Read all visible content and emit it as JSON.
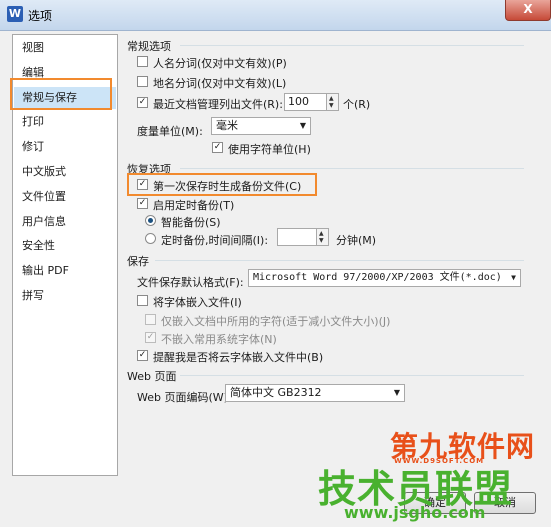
{
  "window": {
    "title": "选项",
    "app_icon": "W",
    "close_glyph": "X"
  },
  "sidebar": {
    "items": [
      {
        "label": "视图"
      },
      {
        "label": "编辑"
      },
      {
        "label": "常规与保存",
        "active": true
      },
      {
        "label": "打印"
      },
      {
        "label": "修订"
      },
      {
        "label": "中文版式"
      },
      {
        "label": "文件位置"
      },
      {
        "label": "用户信息"
      },
      {
        "label": "安全性"
      },
      {
        "label": "输出 PDF"
      },
      {
        "label": "拼写"
      }
    ]
  },
  "general": {
    "title": "常规选项",
    "person_name_segment": {
      "label": "人名分词(仅对中文有效)(P)",
      "checked": false
    },
    "place_name_segment": {
      "label": "地名分词(仅对中文有效)(L)",
      "checked": false
    },
    "recent_docs": {
      "label": "最近文档管理列出文件(R):",
      "checked": true,
      "value": "100",
      "unit": "个(R)"
    },
    "measure_unit_label": "度量单位(M):",
    "measure_unit_value": "毫米",
    "use_char_unit": {
      "label": "使用字符单位(H)",
      "checked": true
    }
  },
  "recovery": {
    "title": "恢复选项",
    "first_save_backup": {
      "label": "第一次保存时生成备份文件(C)",
      "checked": true
    },
    "timed_backup": {
      "label": "启用定时备份(T)",
      "checked": true
    },
    "smart_backup": {
      "label": "智能备份(S)",
      "selected": true
    },
    "interval_backup": {
      "label": "定时备份,时间间隔(I):",
      "selected": false,
      "value": "",
      "unit": "分钟(M)"
    }
  },
  "save": {
    "title": "保存",
    "default_format_label": "文件保存默认格式(F):",
    "default_format_value": "Microsoft Word 97/2000/XP/2003 文件(*.doc)",
    "embed_fonts": {
      "label": "将字体嵌入文件(I)",
      "checked": false
    },
    "embed_used_chars": {
      "label": "仅嵌入文档中所用的字符(适于减小文件大小)(J)",
      "checked": false
    },
    "skip_system_fonts": {
      "label": "不嵌入常用系统字体(N)",
      "checked": true
    },
    "remind_cloud_fonts": {
      "label": "提醒我是否将云字体嵌入文件中(B)",
      "checked": true
    }
  },
  "web": {
    "title": "Web 页面",
    "encoding_label": "Web 页面编码(W):",
    "encoding_value": "简体中文 GB2312"
  },
  "footer": {
    "ok_label": "确定",
    "cancel_label": "取消"
  },
  "watermark": {
    "brand": "第九软件网",
    "brand_url": "WWW.D9SOFT.COM",
    "slogan": "技术员联盟",
    "slogan_url": "www.jsgho.com"
  },
  "colors": {
    "highlight": "#f28a2e",
    "selected_nav": "#cce4f7",
    "dialog_bg": "#f0f0f0"
  }
}
